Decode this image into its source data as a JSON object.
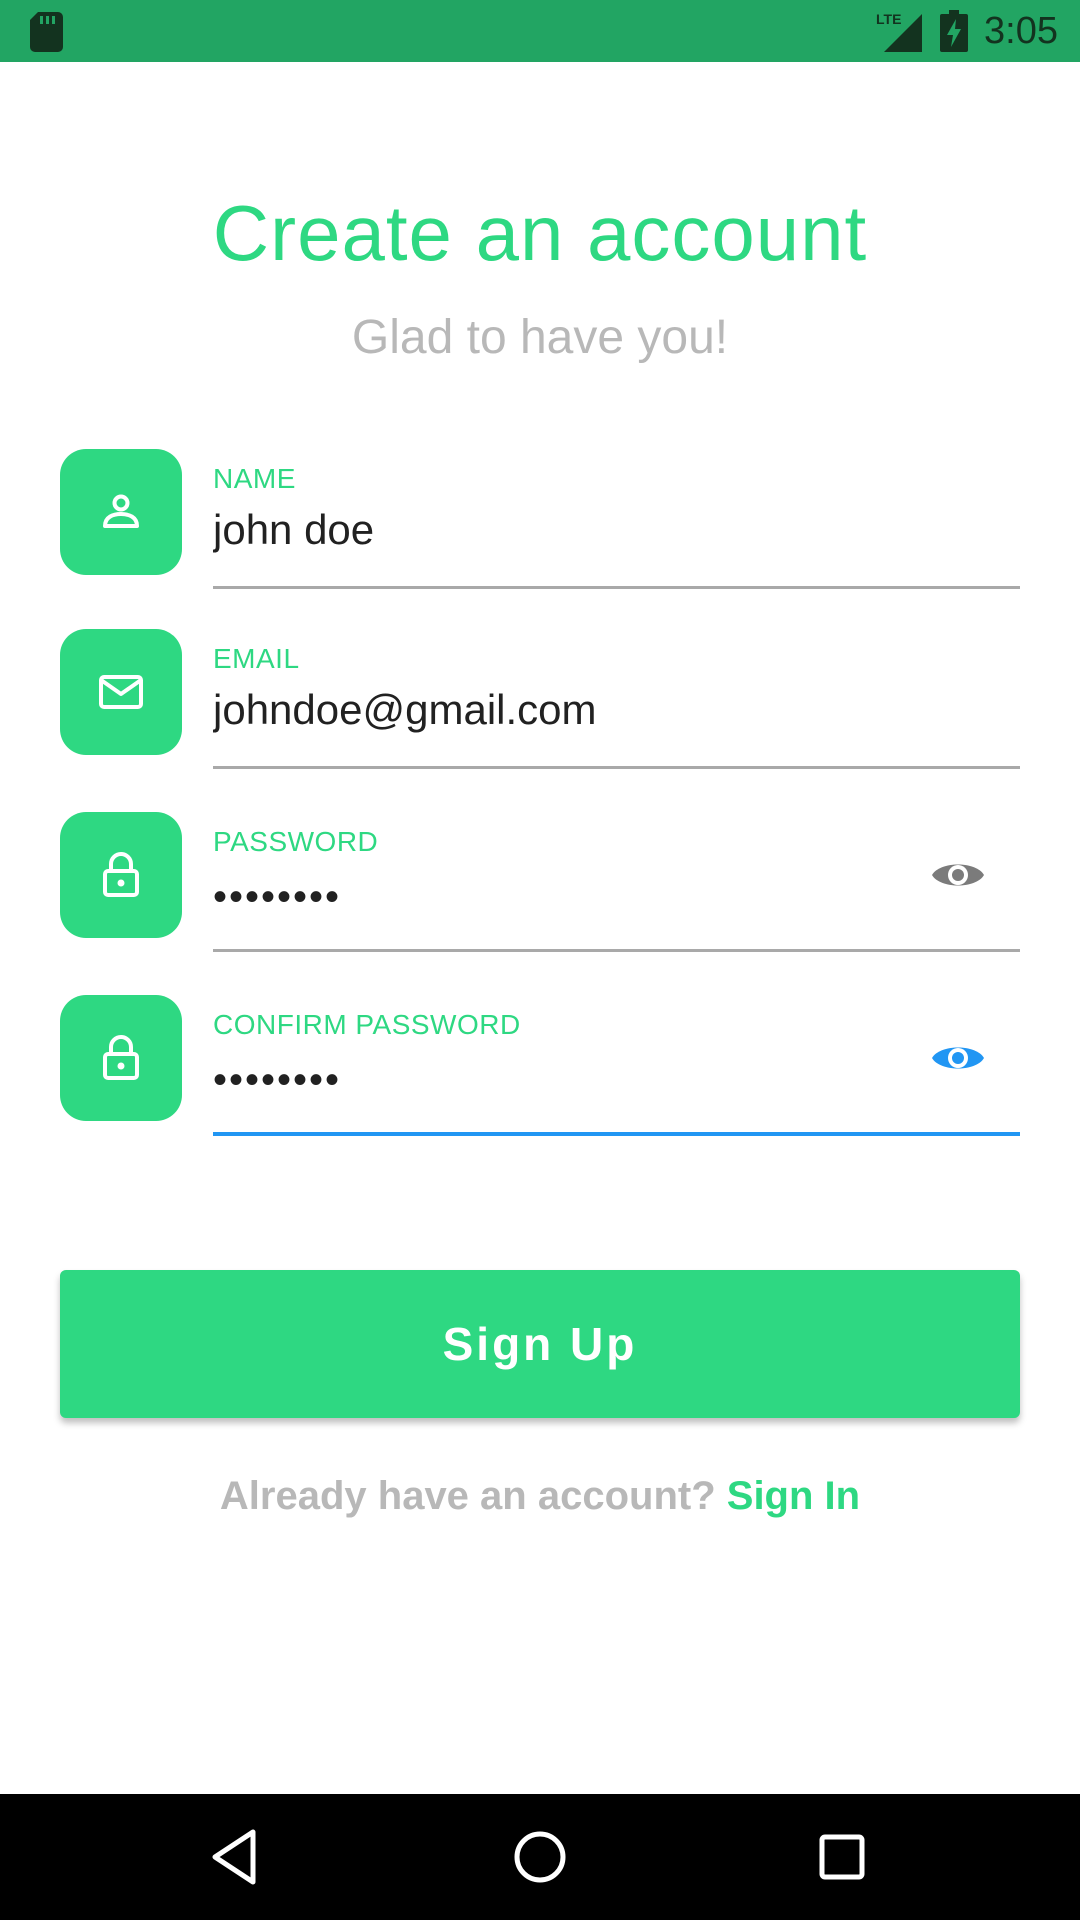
{
  "status_bar": {
    "time": "3:05",
    "network_label": "LTE",
    "icons": [
      "sd-card-icon",
      "lte-signal-icon",
      "battery-charging-icon"
    ]
  },
  "header": {
    "title": "Create an account",
    "subtitle": "Glad to have you!"
  },
  "form": {
    "name": {
      "label": "NAME",
      "value": "john doe",
      "icon": "person-icon"
    },
    "email": {
      "label": "EMAIL",
      "value": "johndoe@gmail.com",
      "icon": "mail-icon"
    },
    "password": {
      "label": "PASSWORD",
      "value": "••••••••",
      "icon": "lock-icon",
      "toggle_icon": "eye-icon"
    },
    "confirm_password": {
      "label": "CONFIRM PASSWORD",
      "value": "••••••••",
      "icon": "lock-icon",
      "toggle_icon": "eye-icon"
    }
  },
  "actions": {
    "signup_label": "Sign Up",
    "signin_prompt": "Already have an account?",
    "signin_link": "Sign In"
  },
  "nav_bar": {
    "icons": [
      "back-icon",
      "home-icon",
      "recents-icon"
    ]
  },
  "colors": {
    "accent": "#2ed882",
    "status_bar": "#22a563",
    "focus": "#2196f3",
    "muted_text": "#b8b8b8",
    "underline": "#a9a9a9"
  }
}
